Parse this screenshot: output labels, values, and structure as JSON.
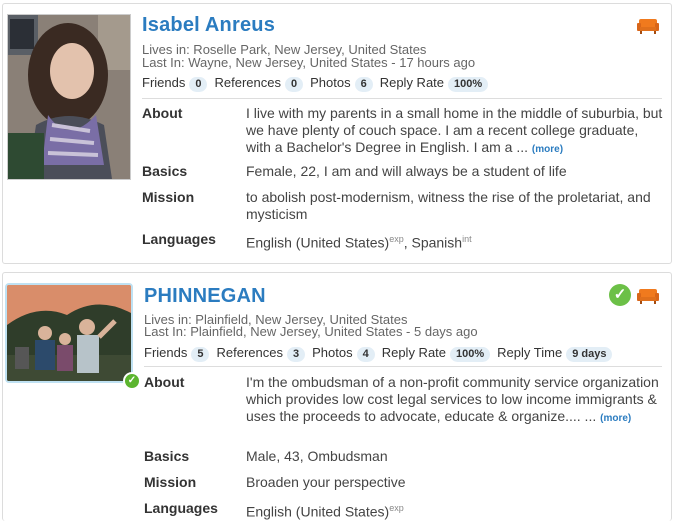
{
  "profiles": [
    {
      "name": "Isabel Anreus",
      "lives_in": "Lives in: Roselle Park, New Jersey, United States",
      "last_in": "Last In:  Wayne, New Jersey, United States - 17 hours ago",
      "stats": {
        "friends_label": "Friends",
        "friends": "0",
        "references_label": "References",
        "references": "0",
        "photos_label": "Photos",
        "photos": "6",
        "reply_rate_label": "Reply Rate",
        "reply_rate": "100%"
      },
      "about_label": "About",
      "about": "I live with my parents in a small home in the middle of suburbia, but we have plenty of couch space. I am a recent college graduate, with a Bachelor's Degree in English. I am a ...",
      "more": "(more)",
      "basics_label": "Basics",
      "basics": "Female, 22, I am and will always be a student of life",
      "mission_label": "Mission",
      "mission": "to abolish post-modernism, witness the rise of the proletariat, and mysticism",
      "languages_label": "Languages",
      "language_1": "English (United States)",
      "language_1_level": "exp",
      "language_sep": ", ",
      "language_2": "Spanish",
      "language_2_level": "int"
    },
    {
      "name": "PHINNEGAN",
      "lives_in": "Lives in: Plainfield, New Jersey, United States",
      "last_in": "Last In:  Plainfield, New Jersey, United States - 5 days ago",
      "stats": {
        "friends_label": "Friends",
        "friends": "5",
        "references_label": "References",
        "references": "3",
        "photos_label": "Photos",
        "photos": "4",
        "reply_rate_label": "Reply Rate",
        "reply_rate": "100%",
        "reply_time_label": "Reply Time",
        "reply_time": "9 days"
      },
      "about_label": "About",
      "about": "I'm the ombudsman of a non-profit community service organization which provides low cost legal services to low income immigrants & uses the proceeds to advocate, educate & organize.... ...",
      "more": "(more)",
      "basics_label": "Basics",
      "basics": "Male, 43, Ombudsman",
      "mission_label": "Mission",
      "mission": "Broaden your perspective",
      "languages_label": "Languages",
      "language_1": "English (United States)",
      "language_1_level": "exp"
    }
  ],
  "icons": {
    "couch": "couch-icon",
    "verified": "verified-check-icon"
  },
  "colors": {
    "name": "#2b7cc0",
    "couch": "#f07a1e",
    "verified": "#6cc047",
    "pill_bg": "#e3eef6"
  }
}
